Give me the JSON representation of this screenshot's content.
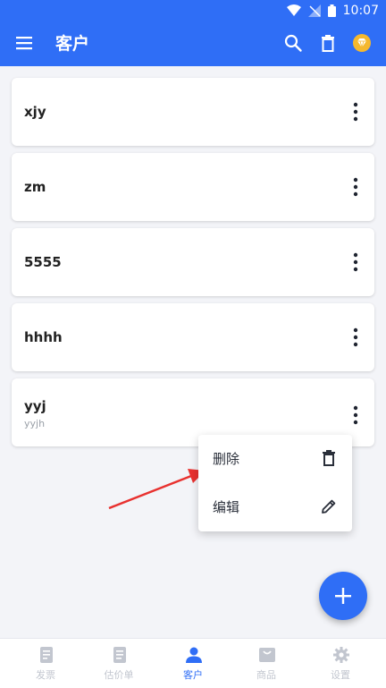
{
  "status_bar": {
    "time": "10:07"
  },
  "app_bar": {
    "title": "客户"
  },
  "customers": [
    {
      "name": "xjy",
      "subtitle": ""
    },
    {
      "name": "zm",
      "subtitle": ""
    },
    {
      "name": "5555",
      "subtitle": ""
    },
    {
      "name": "hhhh",
      "subtitle": ""
    },
    {
      "name": "yyj",
      "subtitle": "yyjh"
    }
  ],
  "context_menu": {
    "delete_label": "删除",
    "edit_label": "编辑"
  },
  "bottom_nav": {
    "items": [
      {
        "label": "发票",
        "icon": "invoice-icon"
      },
      {
        "label": "估价单",
        "icon": "estimate-icon"
      },
      {
        "label": "客户",
        "icon": "person-icon"
      },
      {
        "label": "商品",
        "icon": "product-icon"
      },
      {
        "label": "设置",
        "icon": "gear-icon"
      }
    ],
    "active": "客户"
  },
  "colors": {
    "primary": "#2f6ef6",
    "annotation_arrow": "#e8312f",
    "premium_badge": "#f5b82e"
  }
}
